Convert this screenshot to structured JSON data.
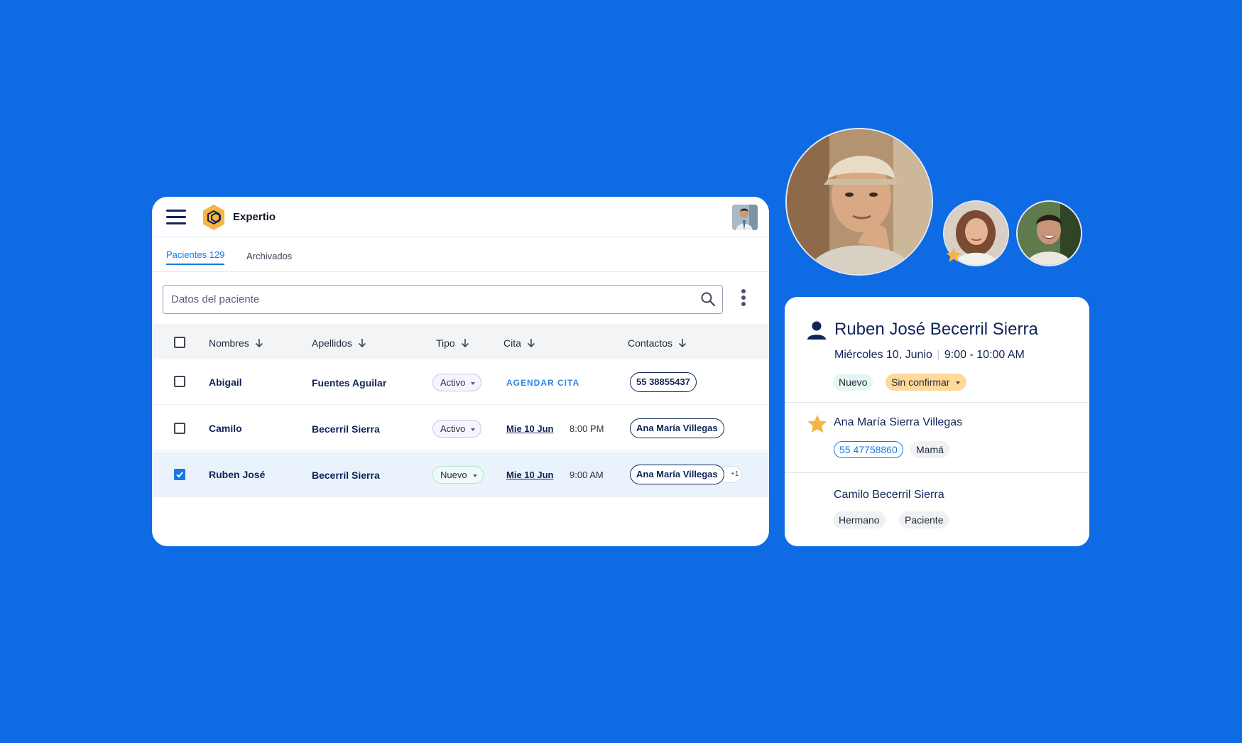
{
  "app": {
    "brand": "Expertio",
    "tabs": [
      {
        "label": "Pacientes 129",
        "active": true
      },
      {
        "label": "Archivados",
        "active": false
      }
    ],
    "search": {
      "placeholder": "Datos del paciente",
      "value": ""
    },
    "columns": [
      "Nombres",
      "Apellidos",
      "Tipo",
      "Cita",
      "Contactos"
    ],
    "rows": [
      {
        "first": "Abigail",
        "last": "Fuentes Aguilar",
        "type": "Activo",
        "appointment_action": "AGENDAR CITA",
        "contact": "55 38855437",
        "selected": false
      },
      {
        "first": "Camilo",
        "last": "Becerril Sierra",
        "type": "Activo",
        "date": "Mie 10 Jun",
        "time": "8:00 PM",
        "contact": "Ana María Villegas",
        "selected": false
      },
      {
        "first": "Ruben José",
        "last": "Becerril Sierra",
        "type": "Nuevo",
        "date": "Mie 10 Jun",
        "time": "9:00 AM",
        "contact": "Ana María Villegas",
        "extra_contacts": "+1",
        "selected": true
      }
    ]
  },
  "detail": {
    "name": "Ruben José Becerril Sierra",
    "date": "Miércoles 10, Junio",
    "time": "9:00 - 10:00 AM",
    "tags": [
      "Nuevo",
      "Sin confirmar"
    ],
    "contacts": [
      {
        "name": "Ana María Sierra Villegas",
        "starred": true,
        "tags": [
          "55 47758860",
          "Mamá"
        ]
      },
      {
        "name": "Camilo Becerril Sierra",
        "starred": false,
        "tags": [
          "Hermano",
          "Paciente"
        ]
      }
    ]
  },
  "colors": {
    "background": "#0F6BE3",
    "primary_text": "#0F2459",
    "accent": "#1877E6",
    "star": "#F5B544",
    "tag_warning": "#FFD99A",
    "tag_new": "#E5F6F2"
  }
}
